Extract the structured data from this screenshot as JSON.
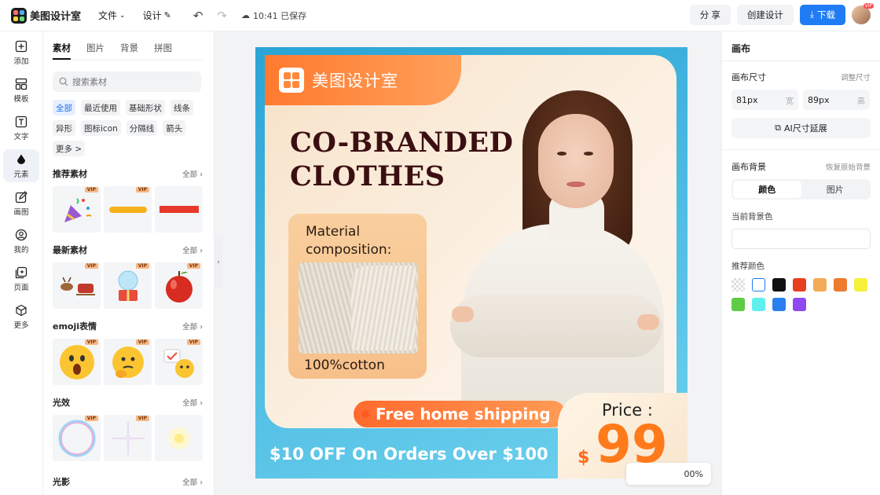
{
  "topbar": {
    "brand": "美图设计室",
    "file_menu": "文件",
    "design_menu": "设计",
    "saved_status": "10:41 已保存",
    "share": "分 享",
    "create": "创建设计",
    "download": "下载",
    "avatar_badge": "VIP"
  },
  "leftnav": [
    {
      "label": "添加",
      "icon": "plus-square-icon"
    },
    {
      "label": "模板",
      "icon": "template-icon"
    },
    {
      "label": "文字",
      "icon": "text-icon"
    },
    {
      "label": "元素",
      "icon": "shapes-icon"
    },
    {
      "label": "画图",
      "icon": "edit-icon"
    },
    {
      "label": "我的",
      "icon": "user-icon"
    },
    {
      "label": "页面",
      "icon": "page-icon"
    },
    {
      "label": "更多",
      "icon": "cube-icon"
    }
  ],
  "panel": {
    "tabs": [
      "素材",
      "图片",
      "背景",
      "拼图"
    ],
    "search_placeholder": "搜索素材",
    "chips": [
      "全部",
      "最近使用",
      "基础形状",
      "线条",
      "异形",
      "图标icon",
      "分隔线",
      "箭头",
      "更多 >"
    ],
    "sections": [
      {
        "title": "推荐素材",
        "all": "全部"
      },
      {
        "title": "最新素材",
        "all": "全部"
      },
      {
        "title": "emoji表情",
        "all": "全部"
      },
      {
        "title": "光效",
        "all": "全部"
      },
      {
        "title": "光影",
        "all": "全部"
      }
    ],
    "vip": "VIP"
  },
  "canvas": {
    "banner": "美图设计室",
    "headline_1": "CO-BRANDED",
    "headline_2": "CLOTHES",
    "material_1": "Material",
    "material_2": "composition:",
    "cotton": "100%cotton",
    "shipping": "Free home shipping",
    "offer": "$10 OFF On Orders Over $100",
    "price_label": "Price :",
    "price_currency": "$",
    "price_value": "99",
    "zoom": "00%"
  },
  "props": {
    "title": "画布",
    "size_label": "画布尺寸",
    "size_adjust": "调整尺寸",
    "width_value": "81px",
    "width_unit": "宽",
    "height_value": "89px",
    "height_unit": "高",
    "ai_button": "AI尺寸延展",
    "bg_label": "画布背景",
    "bg_restore": "恢复原始背景",
    "seg_color": "颜色",
    "seg_image": "图片",
    "current_bg": "当前背景色",
    "recommended": "推荐颜色",
    "swatches": [
      "transparent",
      "#ffffff",
      "#111111",
      "#e8401f",
      "#f3ab57",
      "#ee7b2e",
      "#f6f03d",
      "#5fcc45",
      "#5ff0ee",
      "#2a7ff0",
      "#8e4af0"
    ]
  }
}
